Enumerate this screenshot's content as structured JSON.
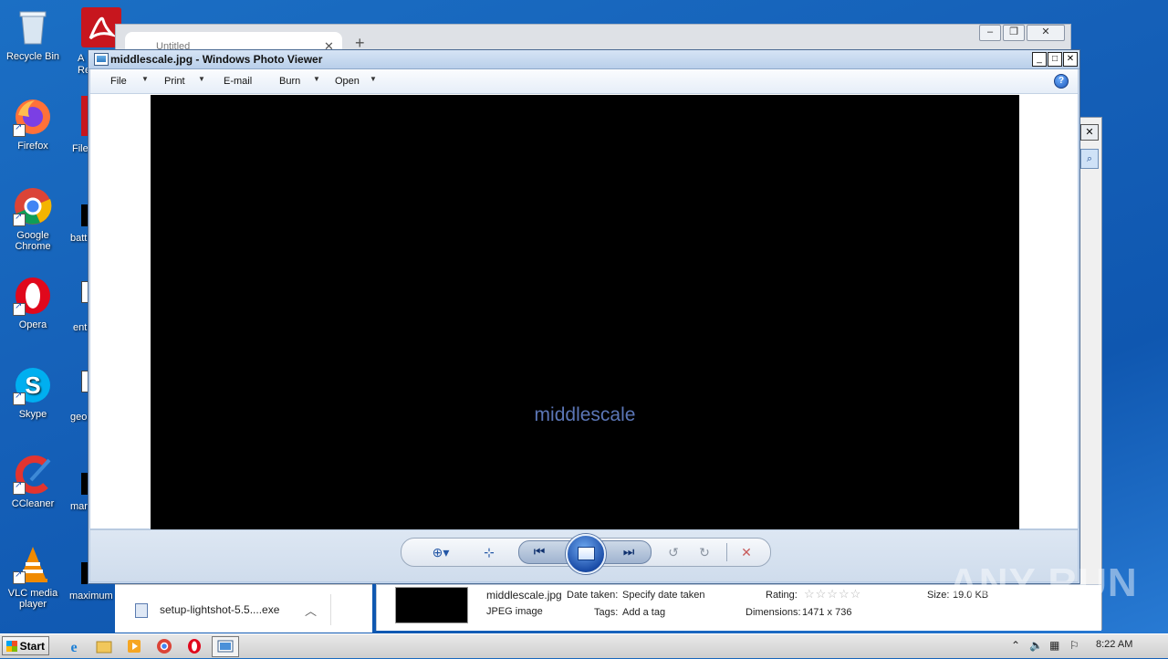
{
  "desktop": {
    "icons": [
      {
        "label": "Recycle Bin",
        "icon": "recycle-bin-icon"
      },
      {
        "label": "Firefox",
        "icon": "firefox-icon"
      },
      {
        "label": "Google Chrome",
        "icon": "chrome-icon"
      },
      {
        "label": "Opera",
        "icon": "opera-icon"
      },
      {
        "label": "Skype",
        "icon": "skype-icon"
      },
      {
        "label": "CCleaner",
        "icon": "ccleaner-icon"
      },
      {
        "label": "VLC media player",
        "icon": "vlc-icon"
      }
    ],
    "partial_icons": [
      {
        "label": "A\nRe"
      },
      {
        "label": "File"
      },
      {
        "label": "batt"
      },
      {
        "label": "ent"
      },
      {
        "label": "geo"
      },
      {
        "label": "mar"
      },
      {
        "label": "maximum"
      }
    ]
  },
  "background_window": {
    "tab_title": "Untitled"
  },
  "photo_viewer": {
    "title": "middlescale.jpg - Windows Photo Viewer",
    "menu": [
      "File",
      "Print",
      "E-mail",
      "Burn",
      "Open"
    ],
    "image_caption": "middlescale"
  },
  "downloads": {
    "file_name": "setup-lightshot-5.5....exe"
  },
  "details": {
    "file_name": "middlescale.jpg",
    "file_type": "JPEG image",
    "date_taken_label": "Date taken:",
    "date_taken_value": "Specify date taken",
    "tags_label": "Tags:",
    "tags_value": "Add a tag",
    "rating_label": "Rating:",
    "dimensions_label": "Dimensions:",
    "dimensions_value": "1471 x 736",
    "size_label": "Size:",
    "size_value": "19.0 KB"
  },
  "watermark": "ANY RUN",
  "taskbar": {
    "start_label": "Start",
    "clock": "8:22 AM"
  },
  "colors": {
    "desktop": "#1560b8",
    "caption": "#5b76b6"
  }
}
